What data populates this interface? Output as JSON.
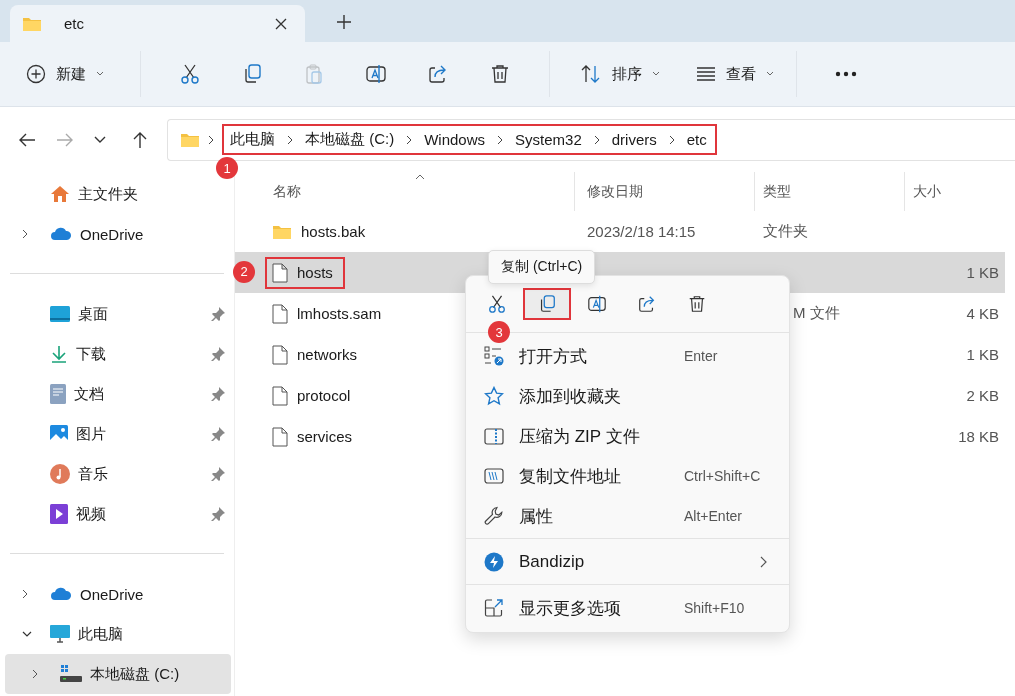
{
  "tab": {
    "title": "etc",
    "selected": true
  },
  "toolbar": {
    "new_button": "新建",
    "paste_disabled": true,
    "sort_button": "排序",
    "view_button": "查看"
  },
  "nav": {
    "forward_disabled": true
  },
  "address": {
    "highlighted": true,
    "badge": "1",
    "crumbs": [
      "此电脑",
      "本地磁盘 (C:)",
      "Windows",
      "System32",
      "drivers",
      "etc"
    ]
  },
  "sidebar": {
    "groups": [
      [
        {
          "label": "主文件夹",
          "kind": "home",
          "selected": false
        },
        {
          "label": "OneDrive",
          "kind": "cloud",
          "expanded": false,
          "selected": false
        }
      ],
      [
        {
          "label": "桌面",
          "kind": "desktop",
          "pinned": true,
          "selected": false
        },
        {
          "label": "下载",
          "kind": "download",
          "pinned": true,
          "selected": false
        },
        {
          "label": "文档",
          "kind": "documents",
          "pinned": true,
          "selected": false
        },
        {
          "label": "图片",
          "kind": "pictures",
          "pinned": true,
          "selected": false
        },
        {
          "label": "音乐",
          "kind": "music",
          "pinned": true,
          "selected": false
        },
        {
          "label": "视频",
          "kind": "videos",
          "pinned": true,
          "selected": false
        }
      ],
      [
        {
          "label": "OneDrive",
          "kind": "cloud",
          "expanded": false,
          "selected": false
        },
        {
          "label": "此电脑",
          "kind": "pc",
          "expanded": true,
          "selected": false,
          "children": [
            {
              "label": "本地磁盘 (C:)",
              "kind": "drive",
              "expanded": false,
              "selected": true
            }
          ]
        }
      ]
    ]
  },
  "files": {
    "columns": [
      "名称",
      "修改日期",
      "类型",
      "大小"
    ],
    "rows": [
      {
        "name": "hosts.bak",
        "kind": "folder",
        "date": "2023/2/18 14:15",
        "type": "文件夹",
        "size": "",
        "selected": false,
        "highlighted": false
      },
      {
        "name": "hosts",
        "kind": "file",
        "size": "1 KB",
        "selected": true,
        "highlighted": true,
        "badge": "2"
      },
      {
        "name": "lmhosts.sam",
        "kind": "file",
        "type": "M 文件",
        "size": "4 KB",
        "selected": false,
        "highlighted": false
      },
      {
        "name": "networks",
        "kind": "file",
        "size": "1 KB",
        "selected": false,
        "highlighted": false
      },
      {
        "name": "protocol",
        "kind": "file",
        "size": "2 KB",
        "selected": false,
        "highlighted": false
      },
      {
        "name": "services",
        "kind": "file",
        "size": "18 KB",
        "selected": false,
        "highlighted": false
      }
    ]
  },
  "tooltip": "复制 (Ctrl+C)",
  "context_menu": {
    "actions": [
      {
        "kind": "cut",
        "highlighted": false
      },
      {
        "kind": "copy",
        "highlighted": true,
        "badge": "3"
      },
      {
        "kind": "rename",
        "highlighted": false
      },
      {
        "kind": "share",
        "highlighted": false
      },
      {
        "kind": "delete",
        "highlighted": false
      }
    ],
    "groups": [
      [
        {
          "label": "打开方式",
          "kind": "open-with",
          "shortcut": "Enter"
        },
        {
          "label": "添加到收藏夹",
          "kind": "star"
        },
        {
          "label": "压缩为 ZIP 文件",
          "kind": "zip"
        },
        {
          "label": "复制文件地址",
          "kind": "path",
          "shortcut": "Ctrl+Shift+C"
        },
        {
          "label": "属性",
          "kind": "wrench",
          "shortcut": "Alt+Enter"
        }
      ],
      [
        {
          "label": "Bandizip",
          "kind": "bandizip",
          "submenu": true
        }
      ],
      [
        {
          "label": "显示更多选项",
          "kind": "more-options",
          "shortcut": "Shift+F10"
        }
      ]
    ]
  }
}
